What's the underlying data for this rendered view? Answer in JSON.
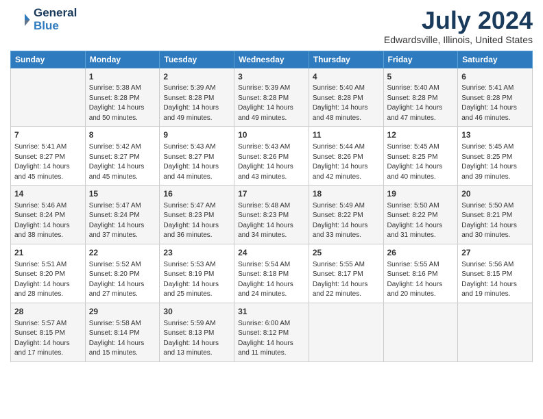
{
  "logo": {
    "line1": "General",
    "line2": "Blue"
  },
  "title": "July 2024",
  "location": "Edwardsville, Illinois, United States",
  "days_header": [
    "Sunday",
    "Monday",
    "Tuesday",
    "Wednesday",
    "Thursday",
    "Friday",
    "Saturday"
  ],
  "weeks": [
    [
      {
        "day": "",
        "content": ""
      },
      {
        "day": "1",
        "content": "Sunrise: 5:38 AM\nSunset: 8:28 PM\nDaylight: 14 hours\nand 50 minutes."
      },
      {
        "day": "2",
        "content": "Sunrise: 5:39 AM\nSunset: 8:28 PM\nDaylight: 14 hours\nand 49 minutes."
      },
      {
        "day": "3",
        "content": "Sunrise: 5:39 AM\nSunset: 8:28 PM\nDaylight: 14 hours\nand 49 minutes."
      },
      {
        "day": "4",
        "content": "Sunrise: 5:40 AM\nSunset: 8:28 PM\nDaylight: 14 hours\nand 48 minutes."
      },
      {
        "day": "5",
        "content": "Sunrise: 5:40 AM\nSunset: 8:28 PM\nDaylight: 14 hours\nand 47 minutes."
      },
      {
        "day": "6",
        "content": "Sunrise: 5:41 AM\nSunset: 8:28 PM\nDaylight: 14 hours\nand 46 minutes."
      }
    ],
    [
      {
        "day": "7",
        "content": "Sunrise: 5:41 AM\nSunset: 8:27 PM\nDaylight: 14 hours\nand 45 minutes."
      },
      {
        "day": "8",
        "content": "Sunrise: 5:42 AM\nSunset: 8:27 PM\nDaylight: 14 hours\nand 45 minutes."
      },
      {
        "day": "9",
        "content": "Sunrise: 5:43 AM\nSunset: 8:27 PM\nDaylight: 14 hours\nand 44 minutes."
      },
      {
        "day": "10",
        "content": "Sunrise: 5:43 AM\nSunset: 8:26 PM\nDaylight: 14 hours\nand 43 minutes."
      },
      {
        "day": "11",
        "content": "Sunrise: 5:44 AM\nSunset: 8:26 PM\nDaylight: 14 hours\nand 42 minutes."
      },
      {
        "day": "12",
        "content": "Sunrise: 5:45 AM\nSunset: 8:25 PM\nDaylight: 14 hours\nand 40 minutes."
      },
      {
        "day": "13",
        "content": "Sunrise: 5:45 AM\nSunset: 8:25 PM\nDaylight: 14 hours\nand 39 minutes."
      }
    ],
    [
      {
        "day": "14",
        "content": "Sunrise: 5:46 AM\nSunset: 8:24 PM\nDaylight: 14 hours\nand 38 minutes."
      },
      {
        "day": "15",
        "content": "Sunrise: 5:47 AM\nSunset: 8:24 PM\nDaylight: 14 hours\nand 37 minutes."
      },
      {
        "day": "16",
        "content": "Sunrise: 5:47 AM\nSunset: 8:23 PM\nDaylight: 14 hours\nand 36 minutes."
      },
      {
        "day": "17",
        "content": "Sunrise: 5:48 AM\nSunset: 8:23 PM\nDaylight: 14 hours\nand 34 minutes."
      },
      {
        "day": "18",
        "content": "Sunrise: 5:49 AM\nSunset: 8:22 PM\nDaylight: 14 hours\nand 33 minutes."
      },
      {
        "day": "19",
        "content": "Sunrise: 5:50 AM\nSunset: 8:22 PM\nDaylight: 14 hours\nand 31 minutes."
      },
      {
        "day": "20",
        "content": "Sunrise: 5:50 AM\nSunset: 8:21 PM\nDaylight: 14 hours\nand 30 minutes."
      }
    ],
    [
      {
        "day": "21",
        "content": "Sunrise: 5:51 AM\nSunset: 8:20 PM\nDaylight: 14 hours\nand 28 minutes."
      },
      {
        "day": "22",
        "content": "Sunrise: 5:52 AM\nSunset: 8:20 PM\nDaylight: 14 hours\nand 27 minutes."
      },
      {
        "day": "23",
        "content": "Sunrise: 5:53 AM\nSunset: 8:19 PM\nDaylight: 14 hours\nand 25 minutes."
      },
      {
        "day": "24",
        "content": "Sunrise: 5:54 AM\nSunset: 8:18 PM\nDaylight: 14 hours\nand 24 minutes."
      },
      {
        "day": "25",
        "content": "Sunrise: 5:55 AM\nSunset: 8:17 PM\nDaylight: 14 hours\nand 22 minutes."
      },
      {
        "day": "26",
        "content": "Sunrise: 5:55 AM\nSunset: 8:16 PM\nDaylight: 14 hours\nand 20 minutes."
      },
      {
        "day": "27",
        "content": "Sunrise: 5:56 AM\nSunset: 8:15 PM\nDaylight: 14 hours\nand 19 minutes."
      }
    ],
    [
      {
        "day": "28",
        "content": "Sunrise: 5:57 AM\nSunset: 8:15 PM\nDaylight: 14 hours\nand 17 minutes."
      },
      {
        "day": "29",
        "content": "Sunrise: 5:58 AM\nSunset: 8:14 PM\nDaylight: 14 hours\nand 15 minutes."
      },
      {
        "day": "30",
        "content": "Sunrise: 5:59 AM\nSunset: 8:13 PM\nDaylight: 14 hours\nand 13 minutes."
      },
      {
        "day": "31",
        "content": "Sunrise: 6:00 AM\nSunset: 8:12 PM\nDaylight: 14 hours\nand 11 minutes."
      },
      {
        "day": "",
        "content": ""
      },
      {
        "day": "",
        "content": ""
      },
      {
        "day": "",
        "content": ""
      }
    ]
  ]
}
